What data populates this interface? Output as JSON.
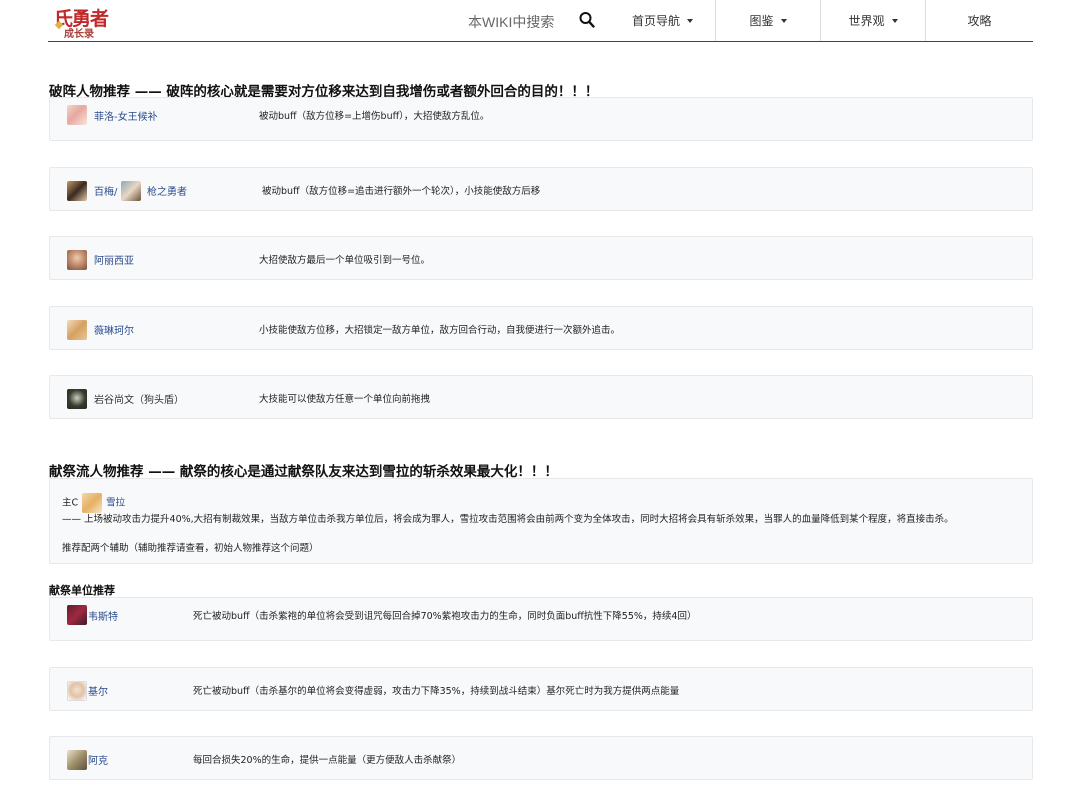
{
  "header": {
    "logo_line1": "氏勇者",
    "logo_line2": "成长录",
    "search_placeholder": "本WIKI中搜索",
    "nav": [
      {
        "label": "首页导航",
        "has_dropdown": true
      },
      {
        "label": "图鉴",
        "has_dropdown": true
      },
      {
        "label": "世界观",
        "has_dropdown": true
      },
      {
        "label": "攻略",
        "has_dropdown": false
      }
    ]
  },
  "section1": {
    "title": "破阵人物推荐 —— 破阵的核心就是需要对方位移来达到自我增伤或者额外回合的目的！！！",
    "rows": [
      {
        "name": "菲洛-女王候补",
        "desc": "被动buff（敌方位移=上增伤buff），大招使敌方乱位。"
      },
      {
        "name_a": "百梅/",
        "name_b": "枪之勇者",
        "desc": "被动buff（敌方位移=追击进行额外一个轮次），小技能使敌方后移"
      },
      {
        "name": "阿丽西亚",
        "desc": "大招使敌方最后一个单位吸引到一号位。"
      },
      {
        "name": "薇琳珂尔",
        "desc": "小技能使敌方位移，大招锁定一敌方单位，敌方回合行动，自我便进行一次额外追击。"
      },
      {
        "name": "岩谷尚文（狗头盾）",
        "desc": "大技能可以使敌方任意一个单位向前拖拽"
      }
    ]
  },
  "section2": {
    "title": "献祭流人物推荐 —— 献祭的核心是通过献祭队友来达到雪拉的斩杀效果最大化！！！",
    "main_prefix": "主C",
    "main_name": "雪拉",
    "main_desc": "—— 上场被动攻击力提升40%,大招有制裁效果，当敌方单位击杀我方单位后，将会成为罪人，雪拉攻击范围将会由前两个变为全体攻击，同时大招将会具有斩杀效果，当罪人的血量降低到某个程度，将直接击杀。",
    "recommend": "推荐配两个辅助（辅助推荐请查看，初始人物推荐这个问题）",
    "sub_title": "献祭单位推荐",
    "rows": [
      {
        "name": "韦斯特",
        "desc": "死亡被动buff（击杀紫袍的单位将会受到诅咒每回合掉70%紫袍攻击力的生命，同时负面buff抗性下降55%，持续4回）"
      },
      {
        "name": "基尔",
        "desc": "死亡被动buff（击杀基尔的单位将会变得虚弱，攻击力下降35%，持续到战斗结束）基尔死亡时为我方提供两点能量"
      },
      {
        "name": "阿克",
        "desc": "每回合损失20%的生命，提供一点能量（更方便敌人击杀献祭）"
      }
    ]
  }
}
